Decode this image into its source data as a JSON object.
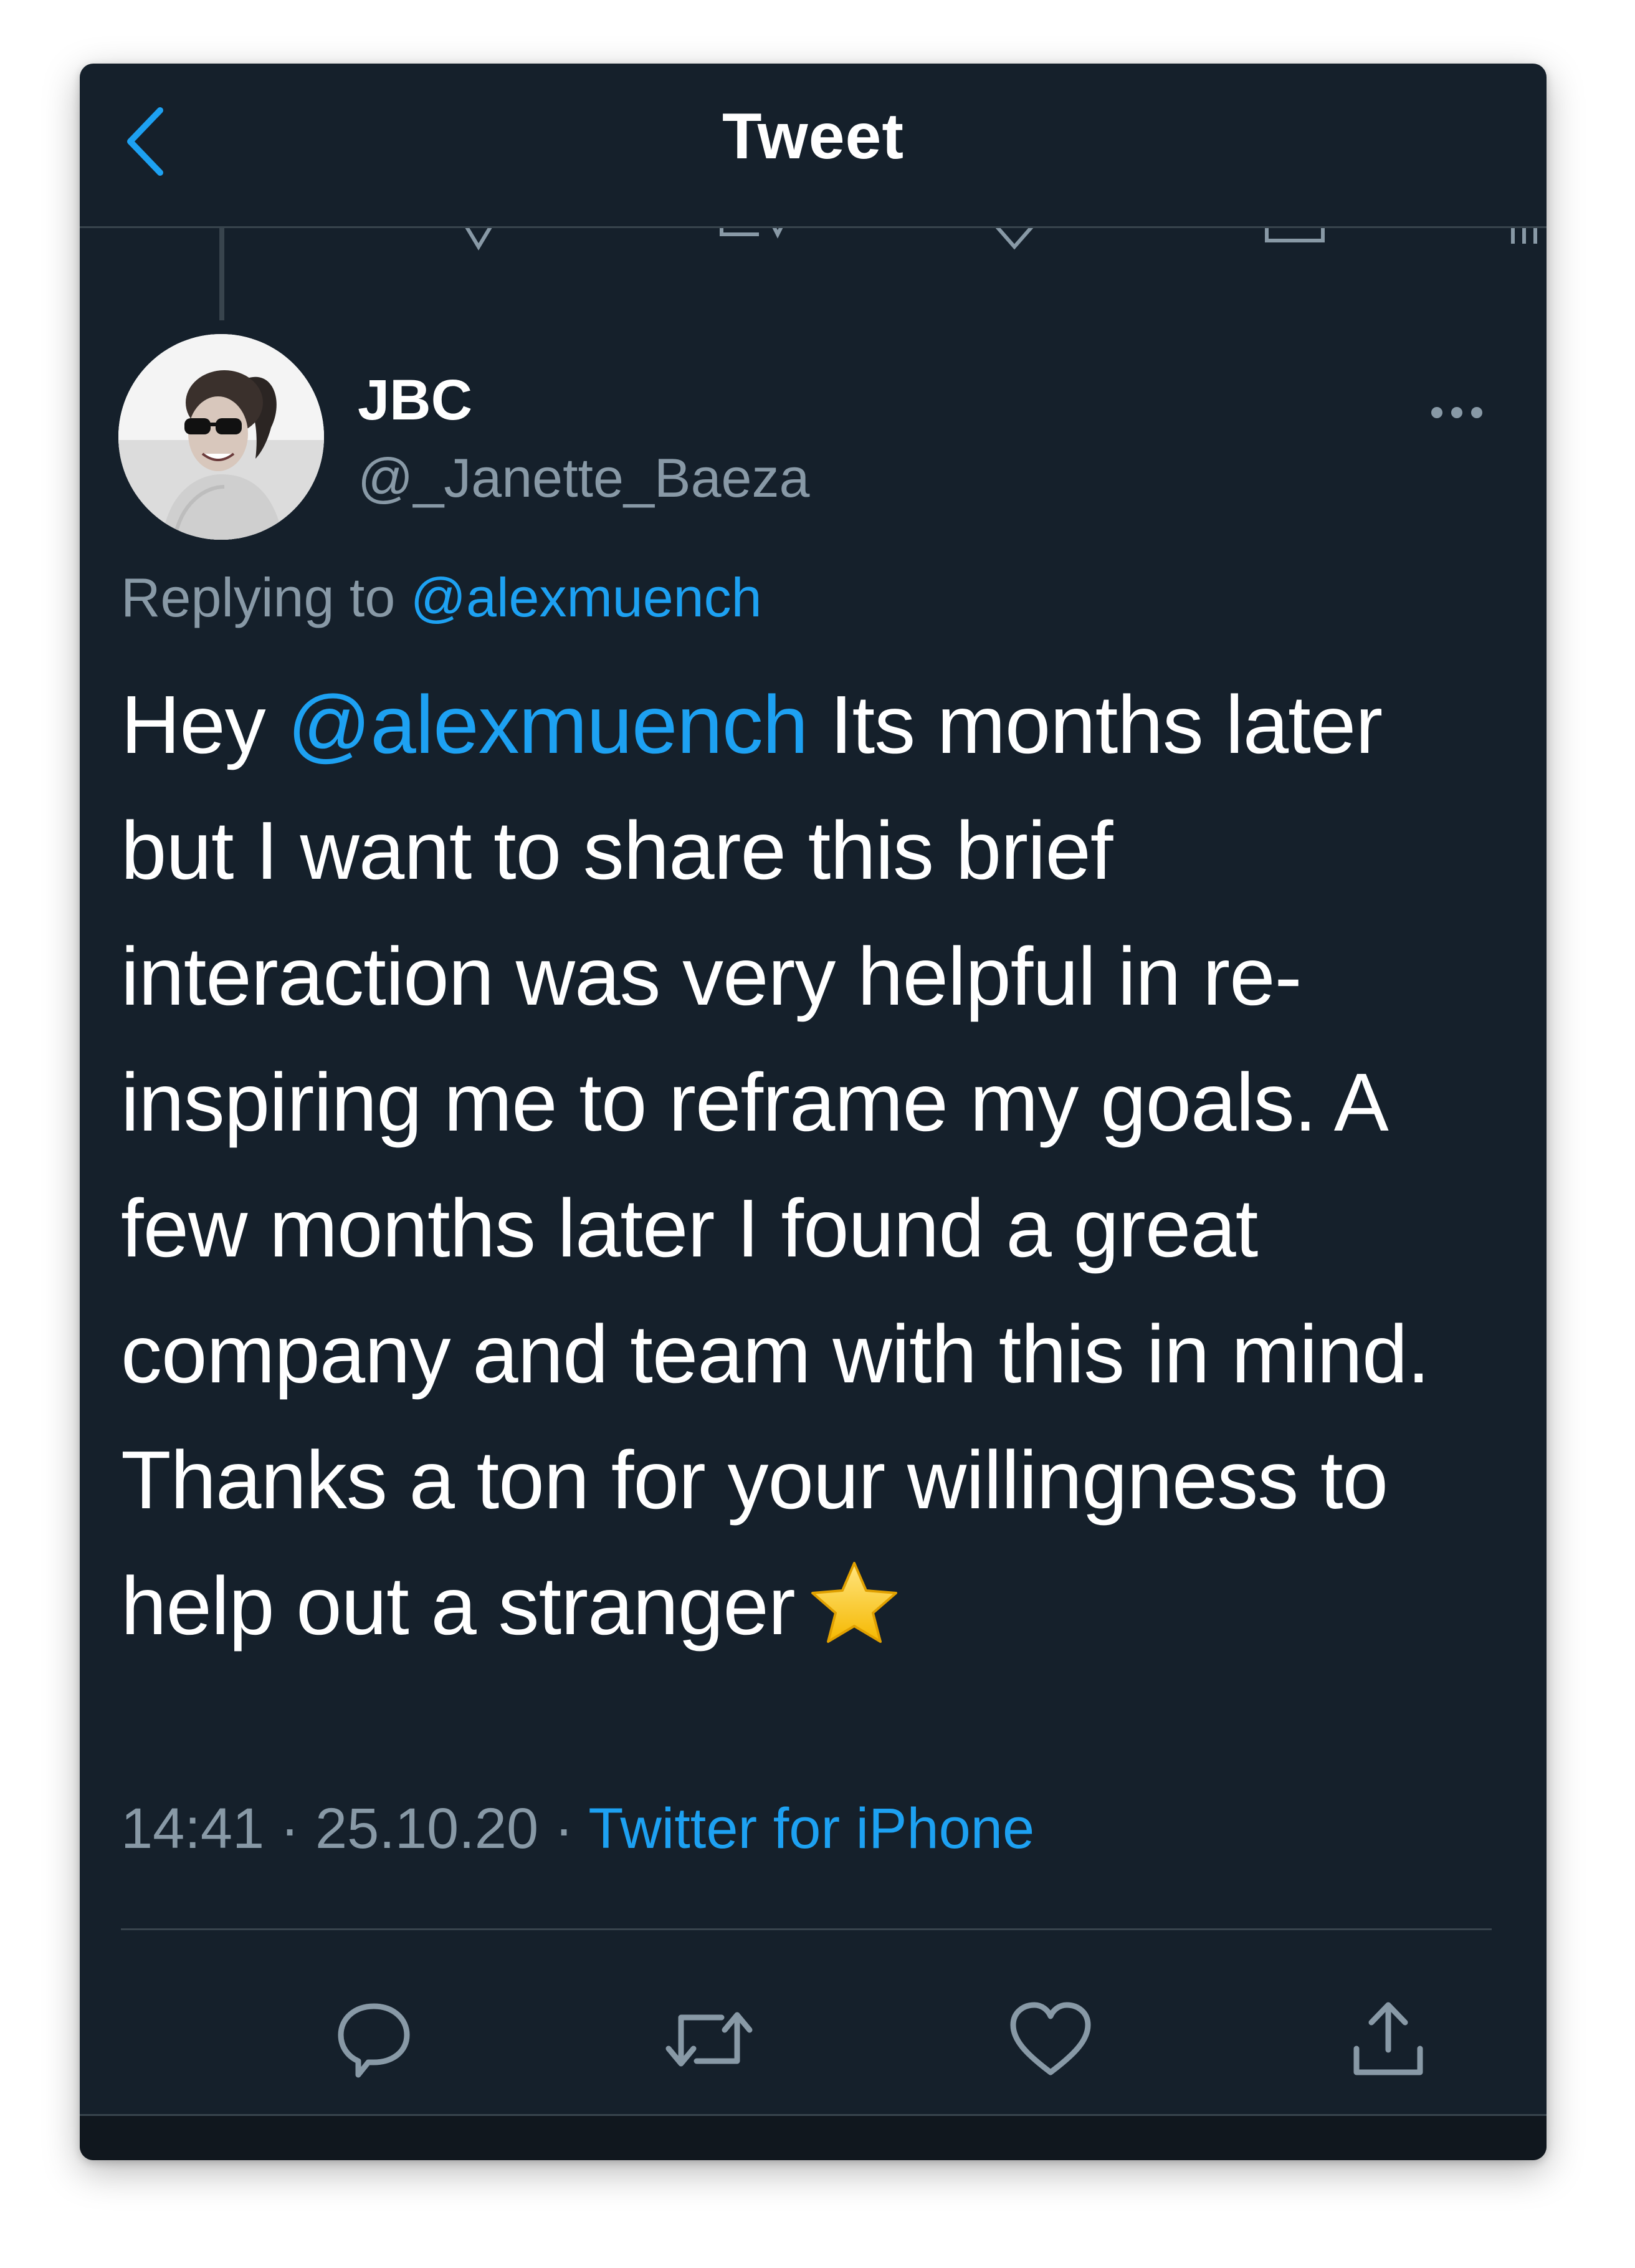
{
  "header": {
    "title": "Tweet",
    "back_icon": "chevron-left-icon"
  },
  "tweet": {
    "author_name": "JBC",
    "author_handle": "@_Janette_Baeza",
    "replying_prefix": "Replying to",
    "replying_to": "@alexmuench",
    "text_lines": [
      {
        "pre": "Hey ",
        "mention": "@alexmuench",
        "post": " Its months later"
      },
      "but I want to share this brief",
      "interaction was very helpful in re-",
      "inspiring me to reframe my goals. A",
      "few months later I found a great",
      "company and team with this in mind.",
      "Thanks a ton for your willingness to",
      "help out a stranger"
    ],
    "emoji": "star-emoji",
    "time": "14:41",
    "date": "25.10.20",
    "separator": "·",
    "source": "Twitter for iPhone"
  },
  "actions": [
    "reply-icon",
    "retweet-icon",
    "like-icon",
    "share-icon"
  ],
  "colors": {
    "background": "#15202b",
    "accent": "#1da1f2",
    "text": "#ffffff",
    "secondary_text": "#8899a6",
    "border": "#38444d"
  }
}
